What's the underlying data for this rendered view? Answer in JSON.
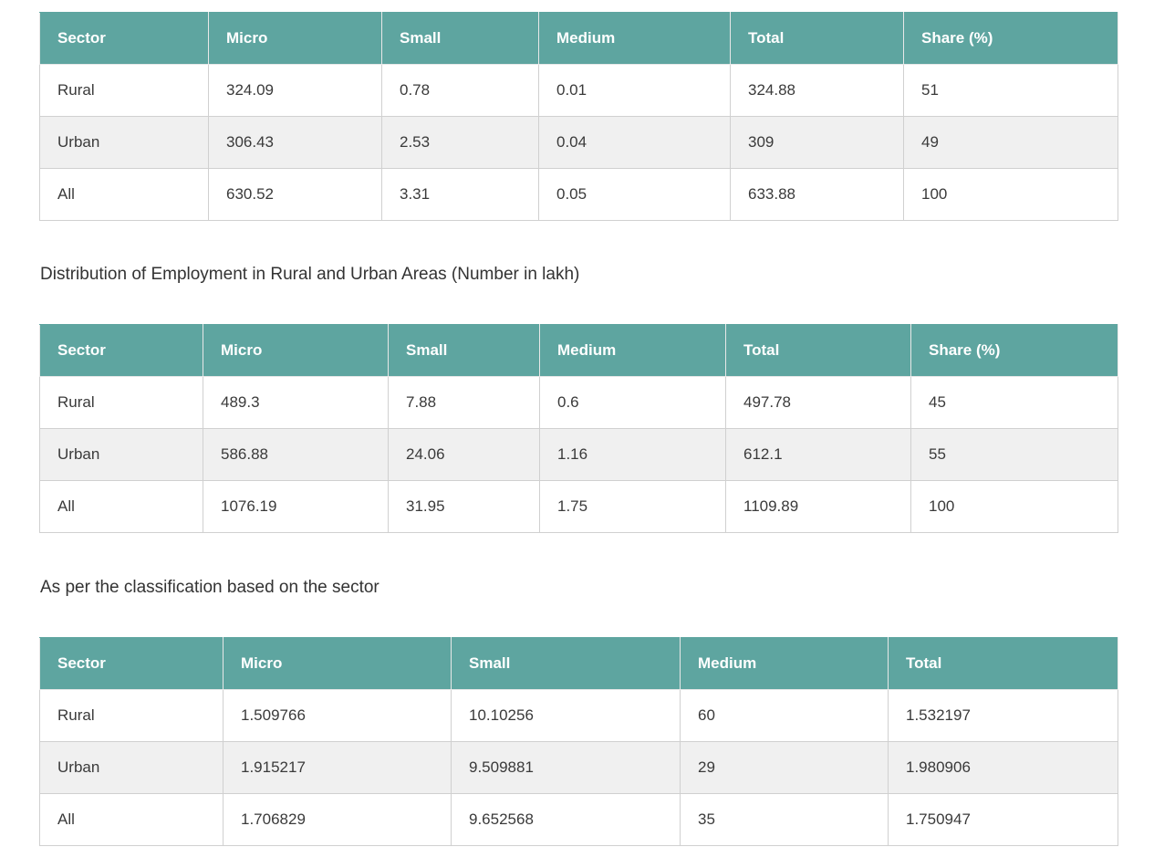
{
  "tables": [
    {
      "headers": [
        "Sector",
        "Micro",
        "Small",
        "Medium",
        "Total",
        "Share (%)"
      ],
      "rows": [
        [
          "Rural",
          "324.09",
          "0.78",
          "0.01",
          "324.88",
          "51"
        ],
        [
          "Urban",
          "306.43",
          "2.53",
          "0.04",
          "309",
          "49"
        ],
        [
          "All",
          "630.52",
          "3.31",
          "0.05",
          "633.88",
          "100"
        ]
      ]
    },
    {
      "headers": [
        "Sector",
        "Micro",
        "Small",
        "Medium",
        "Total",
        "Share (%)"
      ],
      "rows": [
        [
          "Rural",
          "489.3",
          "7.88",
          "0.6",
          "497.78",
          "45"
        ],
        [
          "Urban",
          "586.88",
          "24.06",
          "1.16",
          "612.1",
          "55"
        ],
        [
          "All",
          "1076.19",
          "31.95",
          "1.75",
          "1109.89",
          "100"
        ]
      ]
    },
    {
      "headers": [
        "Sector",
        "Micro",
        "Small",
        "Medium",
        "Total"
      ],
      "rows": [
        [
          "Rural",
          "1.509766",
          "10.10256",
          "60",
          "1.532197"
        ],
        [
          "Urban",
          "1.915217",
          "9.509881",
          "29",
          "1.980906"
        ],
        [
          "All",
          "1.706829",
          "9.652568",
          "35",
          "1.750947"
        ]
      ]
    }
  ],
  "captions": [
    "Distribution of Employment in Rural and Urban Areas (Number in lakh)",
    "As per the classification based on the sector"
  ],
  "colors": {
    "header_bg": "#5ea5a0",
    "header_text": "#ffffff",
    "row_alt_bg": "#f0f0f0",
    "border": "#d0d0d0"
  }
}
